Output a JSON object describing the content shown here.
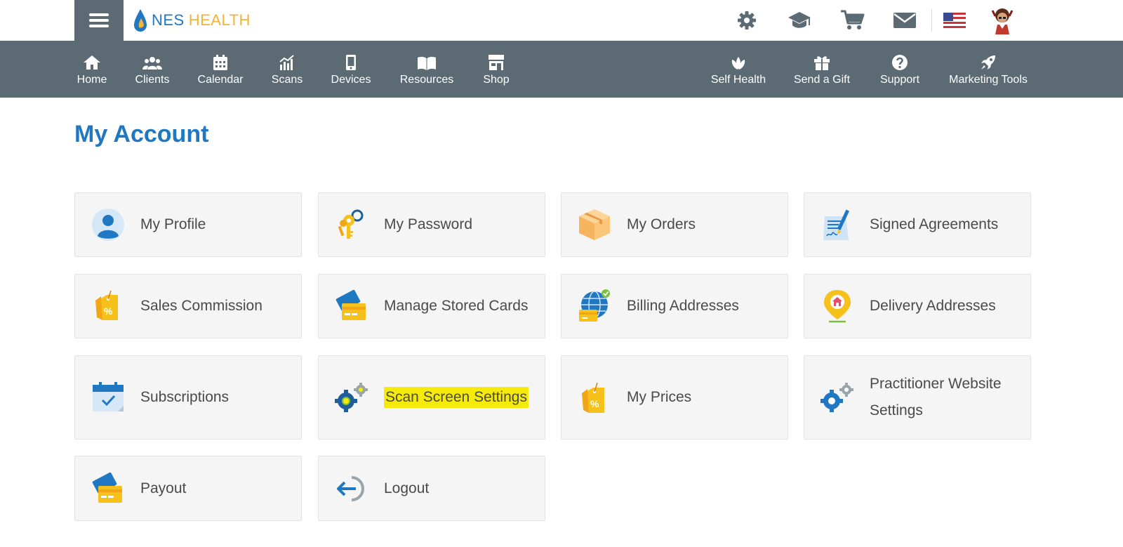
{
  "header": {
    "logo_nes": "NES",
    "logo_health": "HEALTH",
    "icons": [
      "gear-icon",
      "graduation-cap-icon",
      "cart-icon",
      "envelope-icon",
      "us-flag-icon",
      "avatar"
    ]
  },
  "nav": {
    "left": [
      {
        "label": "Home",
        "icon": "home-icon"
      },
      {
        "label": "Clients",
        "icon": "users-icon"
      },
      {
        "label": "Calendar",
        "icon": "calendar-icon"
      },
      {
        "label": "Scans",
        "icon": "chart-icon"
      },
      {
        "label": "Devices",
        "icon": "device-icon"
      },
      {
        "label": "Resources",
        "icon": "book-icon"
      },
      {
        "label": "Shop",
        "icon": "store-icon"
      }
    ],
    "right": [
      {
        "label": "Self Health",
        "icon": "lotus-icon"
      },
      {
        "label": "Send a Gift",
        "icon": "gift-icon"
      },
      {
        "label": "Support",
        "icon": "question-icon"
      },
      {
        "label": "Marketing Tools",
        "icon": "rocket-icon"
      }
    ]
  },
  "page": {
    "title": "My Account"
  },
  "tiles": [
    {
      "label": "My Profile",
      "icon": "profile-icon"
    },
    {
      "label": "My Password",
      "icon": "keys-icon"
    },
    {
      "label": "My Orders",
      "icon": "box-icon"
    },
    {
      "label": "Signed Agreements",
      "icon": "signed-document-icon"
    },
    {
      "label": "Sales Commission",
      "icon": "percent-tag-icon"
    },
    {
      "label": "Manage Stored Cards",
      "icon": "credit-cards-icon"
    },
    {
      "label": "Billing Addresses",
      "icon": "globe-card-icon"
    },
    {
      "label": "Delivery Addresses",
      "icon": "location-pin-icon"
    },
    {
      "label": "Subscriptions",
      "icon": "calendar-check-icon"
    },
    {
      "label": "Scan Screen Settings",
      "icon": "gears-icon",
      "highlighted": true
    },
    {
      "label": "My Prices",
      "icon": "price-tag-icon"
    },
    {
      "label": "Practitioner Website Settings",
      "icon": "blue-gears-icon"
    },
    {
      "label": "Payout",
      "icon": "payout-cards-icon"
    },
    {
      "label": "Logout",
      "icon": "logout-icon"
    }
  ],
  "colors": {
    "brand_blue": "#1f78c1",
    "nav_bg": "#5c6a73",
    "tile_bg": "#f5f5f5",
    "highlight": "#f6ea0a",
    "logo_gold": "#f2b33d"
  }
}
